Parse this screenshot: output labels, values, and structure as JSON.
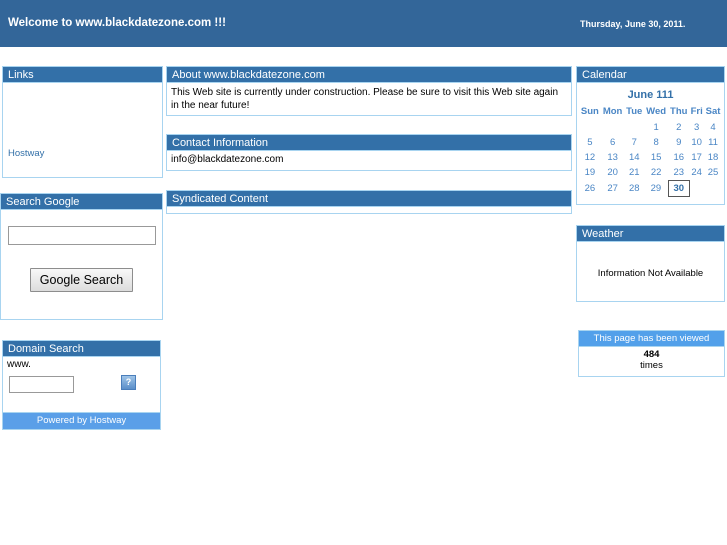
{
  "banner": {
    "title": "Welcome to www.blackdatezone.com !!!",
    "date": "Thursday, June 30, 2011."
  },
  "colors": {
    "banner_bg": "#336699",
    "panel_title_bg": "#3370a8",
    "panel_border": "#a8d4f0",
    "accent_light_blue": "#5a9fe8",
    "counter_title_bg": "#52a0ea",
    "link_blue": "#3370a8"
  },
  "links_panel": {
    "title": "Links",
    "items": [
      {
        "label": "Hostway"
      }
    ]
  },
  "search_google_panel": {
    "title": "Search Google",
    "input_value": "",
    "input_placeholder": "",
    "button_label": "Google Search"
  },
  "domain_search_panel": {
    "title": "Domain Search",
    "prefix_label": "www.",
    "input_value": "",
    "input_placeholder": "",
    "go_icon": "broken-image-icon",
    "go_label": "?",
    "footer_label": "Powered by Hostway"
  },
  "about_panel": {
    "title": "About www.blackdatezone.com",
    "body": "This Web site is currently under construction. Please be sure to visit this Web site again in the near future!"
  },
  "contact_panel": {
    "title": "Contact Information",
    "email": "info@blackdatezone.com"
  },
  "syndicated_panel": {
    "title": "Syndicated Content",
    "body": ""
  },
  "calendar_panel": {
    "title": "Calendar",
    "month_label": "June 111",
    "weekdays": [
      "Sun",
      "Mon",
      "Tue",
      "Wed",
      "Thu",
      "Fri",
      "Sat"
    ],
    "weeks": [
      [
        "",
        "",
        "",
        "1",
        "2",
        "3",
        "4"
      ],
      [
        "5",
        "6",
        "7",
        "8",
        "9",
        "10",
        "11"
      ],
      [
        "12",
        "13",
        "14",
        "15",
        "16",
        "17",
        "18"
      ],
      [
        "19",
        "20",
        "21",
        "22",
        "23",
        "24",
        "25"
      ],
      [
        "26",
        "27",
        "28",
        "29",
        "30",
        "",
        ""
      ]
    ],
    "today": "30"
  },
  "weather_panel": {
    "title": "Weather",
    "message": "Information Not Available"
  },
  "counter_panel": {
    "title": "This page has been viewed",
    "count": "484",
    "unit": "times"
  }
}
